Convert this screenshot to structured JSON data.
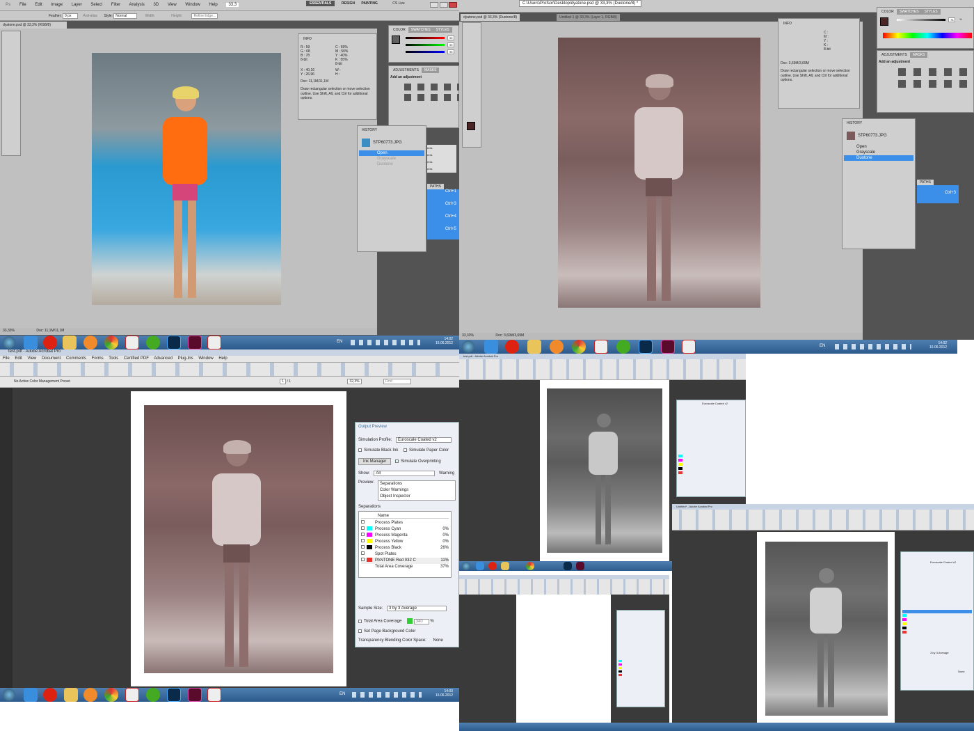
{
  "ps1": {
    "menu": [
      "File",
      "Edit",
      "Image",
      "Layer",
      "Select",
      "Filter",
      "Analysis",
      "3D",
      "View",
      "Window",
      "Help"
    ],
    "zoom_field": "33,3",
    "workspaces": [
      "ESSENTIALS",
      "DESIGN",
      "PAINTING"
    ],
    "cslive": "CS Live",
    "options": {
      "feather_label": "Feather:",
      "feather_value": "0 px",
      "antialias": "Anti-alias",
      "style_label": "Style:",
      "style_value": "Normal",
      "width": "Width:",
      "height": "Height:",
      "refine": "Refine Edge..."
    },
    "doc_tab": "dyatone.psd @ 33,3% (RGB/8)",
    "status_zoom": "33,33%",
    "status_doc": "Doc: 11,1M/11,1M",
    "info": {
      "title": "INFO",
      "rgb": [
        "R :",
        "G :",
        "B :"
      ],
      "rgb_values": [
        "59",
        "68",
        "78"
      ],
      "cmyk": [
        "C :",
        "M :",
        "Y :",
        "K :"
      ],
      "cmyk_values": [
        "69%",
        "50%",
        "40%",
        "55%"
      ],
      "bit1": "8-bit",
      "bit2": "8-bit",
      "xy": [
        "X :",
        "Y :"
      ],
      "xy_values": [
        "40,16",
        "26,96"
      ],
      "wh": [
        "W :",
        "H :"
      ],
      "doc": "Doc: 11,1M/11,1M",
      "hint": "Draw rectangular selection or move selection outline. Use Shift, Alt, and Ctrl for additional options."
    },
    "color_tabs": [
      "COLOR",
      "SWATCHES",
      "STYLES"
    ],
    "color_values": [
      "95",
      "95",
      "95"
    ],
    "adj_tabs": [
      "ADJUSTMENTS",
      "MASKS"
    ],
    "adj_title": "Add an adjustment",
    "history": {
      "title": "HISTORY",
      "snapshot": "STP60773.JPG",
      "items": [
        "Open",
        "Grayscale",
        "Duotone"
      ]
    },
    "side_labels": [
      "ents",
      "ents",
      "ents",
      "ents"
    ],
    "paths_tab": "PATHS",
    "shortcuts": [
      "Ctrl+1",
      "Ctrl+3",
      "Ctrl+4",
      "Ctrl+5"
    ]
  },
  "ps2": {
    "title": "C:\\Users\\Profsor\\Desktop\\dyatone.psd @ 33,3% (Duotone/8) *",
    "doc_tab": "dyatone.psd @ 33,3% (Duotone/8)",
    "doc_tab2": "Untitled-1 @ 33,3% (Layer 1, RGB/8)",
    "status_zoom": "33,33%",
    "status_doc": "Doc: 3,69M/3,69M",
    "info": {
      "title": "INFO",
      "cmyk": [
        "C :",
        "M :",
        "Y :",
        "K :"
      ],
      "bit": "8-bit",
      "doc": "Doc: 3,69M/3,69M",
      "hint": "Draw rectangular selection or move selection outline. Use Shift, Alt, and Ctrl for additional options."
    },
    "color_tabs": [
      "COLOR",
      "SWATCHES",
      "STYLES"
    ],
    "color_value": "76",
    "color_unit": "%",
    "adj_tabs": [
      "ADJUSTMENTS",
      "MASKS"
    ],
    "adj_title": "Add an adjustment",
    "history": {
      "title": "HISTORY",
      "snapshot": "STP60773.JPG",
      "items": [
        "Open",
        "Grayscale",
        "Duotone"
      ]
    },
    "paths_tab": "PATHS",
    "shortcut": "Ctrl+3"
  },
  "taskbar": {
    "lang": "EN",
    "time": "14:02",
    "date": "16.06.2012",
    "time2": "14:03",
    "date2": "16.06.2012"
  },
  "acrobat": {
    "title": "test.pdf - Adobe Acrobat Pro",
    "menu": [
      "File",
      "Edit",
      "View",
      "Document",
      "Comments",
      "Forms",
      "Tools",
      "Certified PDF",
      "Advanced",
      "Plug-Ins",
      "Window",
      "Help"
    ],
    "color_preset": "No Active Color Management Preset",
    "page": "1",
    "page_total": "/ 1",
    "zoom": "32,3%",
    "find": "Find"
  },
  "output_preview": {
    "title": "Output Preview",
    "sim_profile_label": "Simulation Profile:",
    "sim_profile_value": "Euroscale Coated v2",
    "sim_black": "Simulate Black Ink",
    "sim_paper": "Simulate Paper Color",
    "ink_manager": "Ink Manager",
    "sim_overprint": "Simulate Overprinting",
    "show_label": "Show:",
    "show_value": "All",
    "warning": "Warning",
    "preview_label": "Preview:",
    "preview_items": [
      "Separations",
      "Color Warnings",
      "Object Inspector"
    ],
    "separations_label": "Separations",
    "name_header": "Name",
    "separations": [
      {
        "name": "Process Plates",
        "value": "",
        "color": ""
      },
      {
        "name": "Process Cyan",
        "value": "0%",
        "color": "#00ffff"
      },
      {
        "name": "Process Magenta",
        "value": "0%",
        "color": "#ff00ff"
      },
      {
        "name": "Process Yellow",
        "value": "0%",
        "color": "#ffff00"
      },
      {
        "name": "Process Black",
        "value": "26%",
        "color": "#000000"
      },
      {
        "name": "Spot Plates",
        "value": "",
        "color": ""
      },
      {
        "name": "PANTONE Red 032 C",
        "value": "11%",
        "color": "#e8302c"
      },
      {
        "name": "Total Area Coverage",
        "value": "37%",
        "color": ""
      }
    ],
    "sample_label": "Sample Size:",
    "sample_value": "3 by 3 Average",
    "total_area": "Total Area Coverage",
    "total_value": "340",
    "total_unit": "%",
    "page_bg": "Set Page Background Color",
    "blend_label": "Transparency Blending Color Space:",
    "blend_value": "None"
  },
  "small_acrobat": {
    "title": "test.pdf - Adobe Acrobat Pro",
    "title2": "Untitled* - Adobe Acrobat Pro",
    "euroscale": "Euroscale Coated v2",
    "sample": "3 by 3 Average",
    "none": "None"
  }
}
